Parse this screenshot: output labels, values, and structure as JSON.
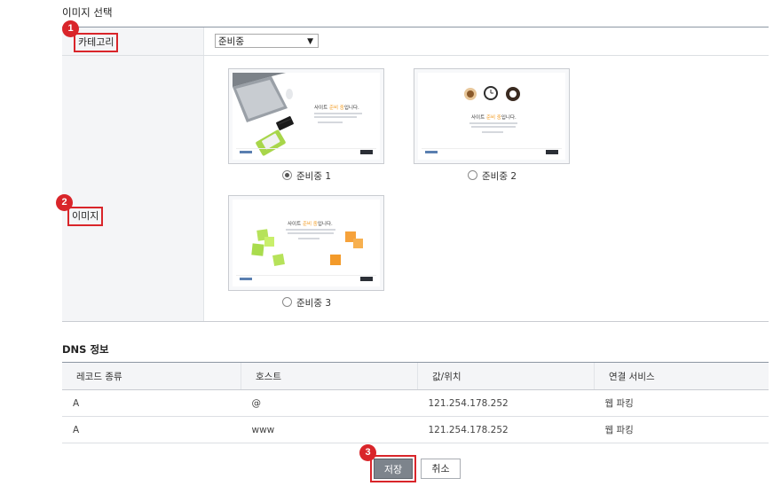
{
  "image_section": {
    "title": "이미지 선택"
  },
  "category": {
    "label": "카테고리",
    "badge": "1",
    "selected": "준비중"
  },
  "image": {
    "label": "이미지",
    "badge": "2",
    "thumbs": [
      {
        "title_pre": "사이트 ",
        "title_hl": "준비 중",
        "title_post": "입니다.",
        "option": "준비중 1",
        "checked": true
      },
      {
        "title_pre": "사이트 ",
        "title_hl": "준비 중",
        "title_post": "입니다.",
        "option": "준비중 2",
        "checked": false
      },
      {
        "title_pre": "사이트 ",
        "title_hl": "준비 중",
        "title_post": "입니다.",
        "option": "준비중 3",
        "checked": false
      }
    ]
  },
  "dns": {
    "title": "DNS 정보",
    "columns": [
      "레코드 종류",
      "호스트",
      "값/위치",
      "연결 서비스"
    ],
    "rows": [
      [
        "A",
        "@",
        "121.254.178.252",
        "웹 파킹"
      ],
      [
        "A",
        "www",
        "121.254.178.252",
        "웹 파킹"
      ]
    ]
  },
  "actions": {
    "save": "저장",
    "save_badge": "3",
    "cancel": "취소"
  },
  "colors": {
    "accent_red": "#d9252a",
    "highlight_orange": "#f29a1f",
    "save_button": "#7d848c"
  }
}
